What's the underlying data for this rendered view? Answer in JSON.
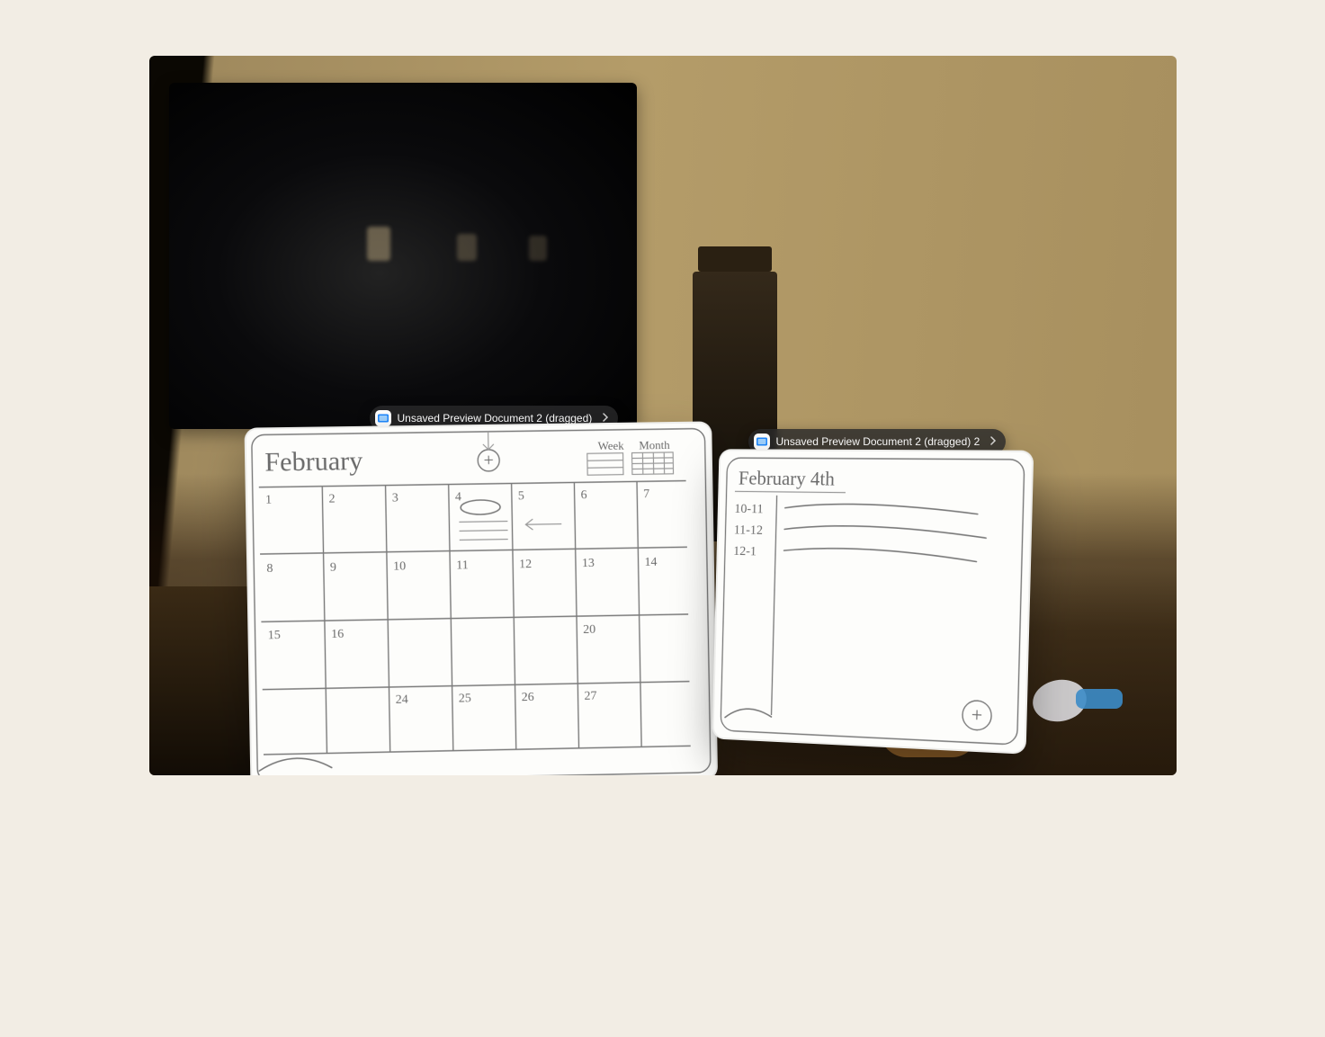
{
  "window1": {
    "title": "Unsaved Preview Document 2 (dragged)",
    "sketch": {
      "month_label": "February",
      "view_toggle": {
        "week": "Week",
        "month": "Month"
      },
      "add_icon": "+",
      "rows": [
        [
          "1",
          "2",
          "3",
          "4",
          "5",
          "6",
          "7"
        ],
        [
          "8",
          "9",
          "10",
          "11",
          "12",
          "13",
          "14"
        ],
        [
          "15",
          "16",
          "",
          "",
          "",
          "20",
          ""
        ],
        [
          "",
          "",
          "24",
          "25",
          "26",
          "27",
          ""
        ]
      ]
    }
  },
  "window2": {
    "title": "Unsaved Preview Document 2 (dragged) 2",
    "sketch": {
      "date_heading": "February 4th",
      "times": [
        "10-11",
        "11-12",
        "12-1"
      ],
      "add_icon": "+"
    }
  },
  "colors": {
    "frame_bg": "#f2ede4",
    "pill_bg": "rgba(40,40,42,0.82)",
    "preview_icon_blue": "#1e88ff"
  }
}
